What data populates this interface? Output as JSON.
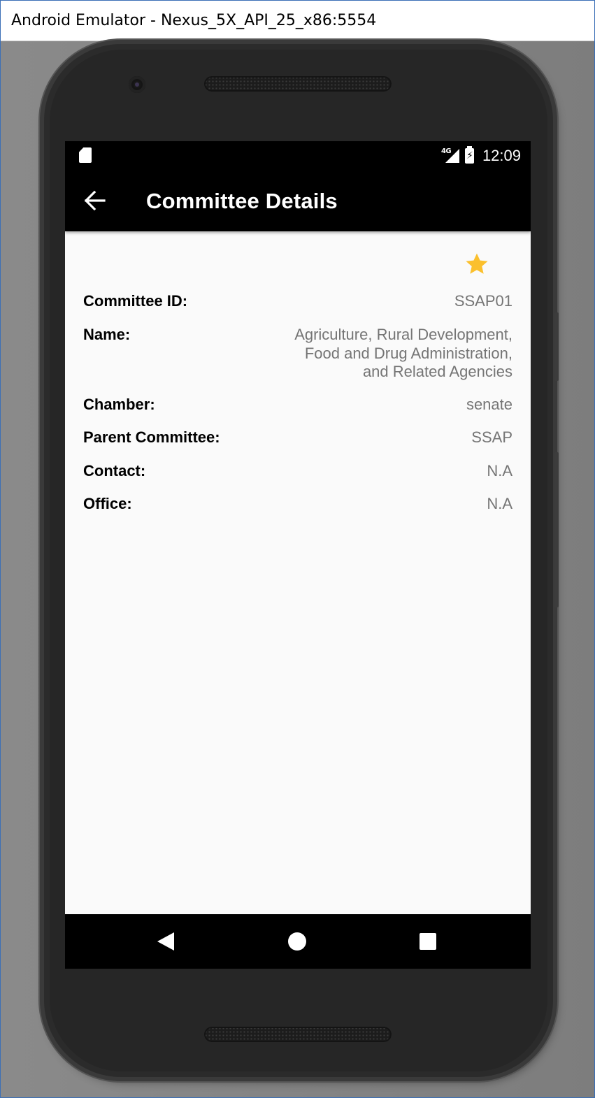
{
  "window": {
    "title": "Android Emulator - Nexus_5X_API_25_x86:5554"
  },
  "statusbar": {
    "left_icons": [
      "sd-card-icon"
    ],
    "network_label": "4G",
    "time": "12:09"
  },
  "appbar": {
    "title": "Committee Details",
    "back_icon": "arrow-back-icon"
  },
  "favorite": {
    "icon": "star-icon",
    "color": "#FBC02D",
    "active": true
  },
  "details": [
    {
      "label": "Committee ID:",
      "value": "SSAP01"
    },
    {
      "label": "Name:",
      "value_lines": [
        "Agriculture, Rural Development,",
        "Food and Drug Administration,",
        "and Related Agencies"
      ]
    },
    {
      "label": "Chamber:",
      "value": "senate"
    },
    {
      "label": "Parent Committee:",
      "value": "SSAP"
    },
    {
      "label": "Contact:",
      "value": "N.A"
    },
    {
      "label": "Office:",
      "value": "N.A"
    }
  ],
  "navbar": {
    "back": "nav-back-icon",
    "home": "nav-home-icon",
    "recents": "nav-recents-icon"
  },
  "colors": {
    "appbar": "#000000",
    "background": "#FAFAFA",
    "label": "#000000",
    "value": "#757575"
  }
}
